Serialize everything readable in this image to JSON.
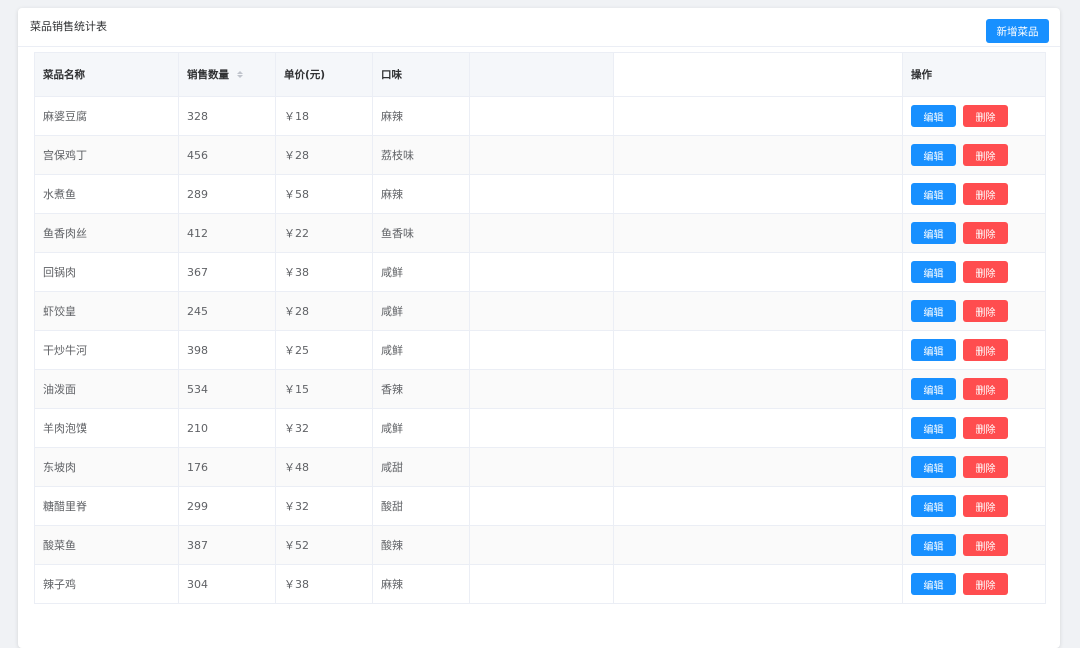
{
  "card": {
    "title": "菜品销售统计表",
    "add_label": "新增菜品"
  },
  "table": {
    "headers": {
      "name": "菜品名称",
      "qty": "销售数量",
      "price": "单价(元)",
      "taste": "口味",
      "ops": "操作"
    },
    "rows": [
      {
        "name": "麻婆豆腐",
        "qty": "328",
        "price": "￥18",
        "taste": "麻辣"
      },
      {
        "name": "宫保鸡丁",
        "qty": "456",
        "price": "￥28",
        "taste": "荔枝味"
      },
      {
        "name": "水煮鱼",
        "qty": "289",
        "price": "￥58",
        "taste": "麻辣"
      },
      {
        "name": "鱼香肉丝",
        "qty": "412",
        "price": "￥22",
        "taste": "鱼香味"
      },
      {
        "name": "回锅肉",
        "qty": "367",
        "price": "￥38",
        "taste": "咸鲜"
      },
      {
        "name": "虾饺皇",
        "qty": "245",
        "price": "￥28",
        "taste": "咸鲜"
      },
      {
        "name": "干炒牛河",
        "qty": "398",
        "price": "￥25",
        "taste": "咸鲜"
      },
      {
        "name": "油泼面",
        "qty": "534",
        "price": "￥15",
        "taste": "香辣"
      },
      {
        "name": "羊肉泡馍",
        "qty": "210",
        "price": "￥32",
        "taste": "咸鲜"
      },
      {
        "name": "东坡肉",
        "qty": "176",
        "price": "￥48",
        "taste": "咸甜"
      },
      {
        "name": "糖醋里脊",
        "qty": "299",
        "price": "￥32",
        "taste": "酸甜"
      },
      {
        "name": "酸菜鱼",
        "qty": "387",
        "price": "￥52",
        "taste": "酸辣"
      },
      {
        "name": "辣子鸡",
        "qty": "304",
        "price": "￥38",
        "taste": "麻辣"
      }
    ],
    "edit_label": "编辑",
    "delete_label": "删除"
  },
  "colors": {
    "primary": "#1890ff",
    "danger": "#ff4d4f"
  }
}
